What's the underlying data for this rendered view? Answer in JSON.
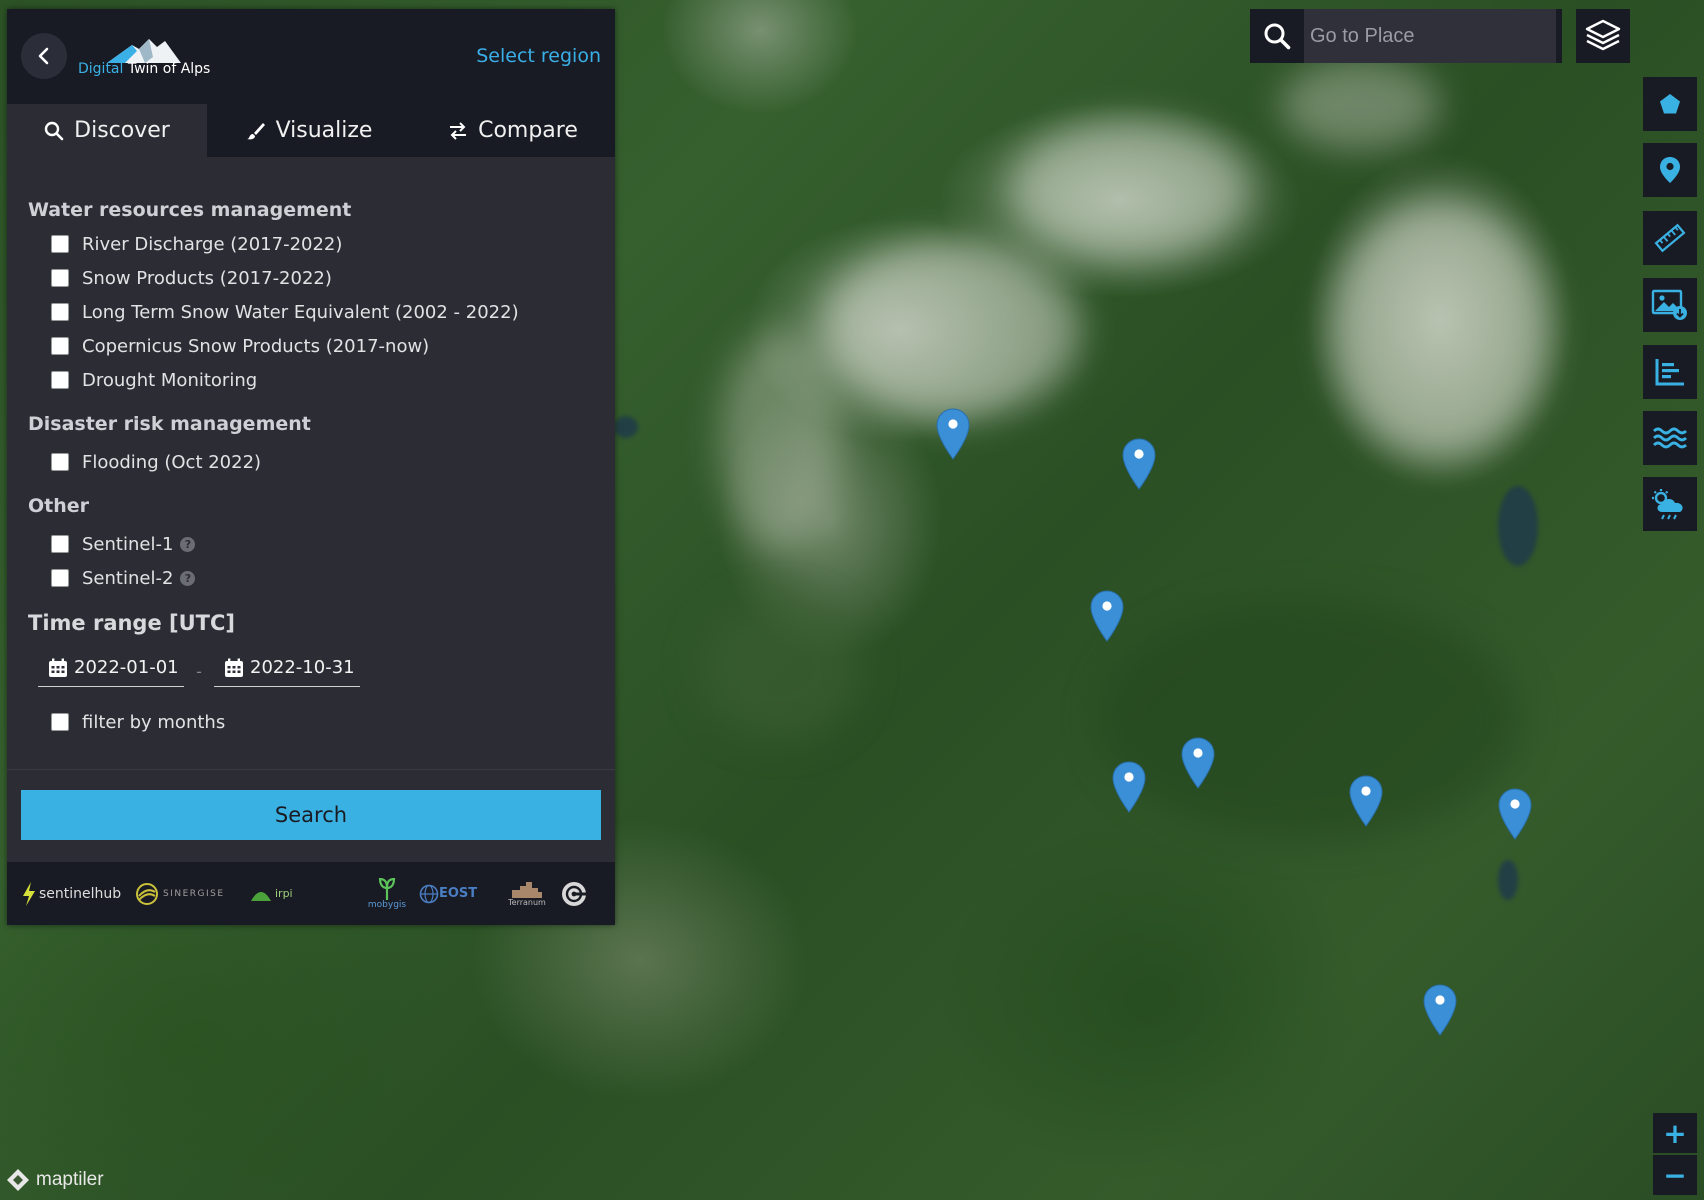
{
  "app": {
    "logo_accent": "Digital",
    "logo_rest": " Twin of Alps",
    "select_region": "Select region"
  },
  "tabs": [
    {
      "label": "Discover",
      "icon": "search-icon",
      "active": true
    },
    {
      "label": "Visualize",
      "icon": "brush-icon",
      "active": false
    },
    {
      "label": "Compare",
      "icon": "swap-icon",
      "active": false
    }
  ],
  "groups": {
    "water": {
      "title": "Water resources management",
      "items": [
        "River Discharge (2017-2022)",
        "Snow Products (2017-2022)",
        "Long Term Snow Water Equivalent (2002 - 2022)",
        "Copernicus Snow Products (2017-now)",
        "Drought Monitoring"
      ]
    },
    "disaster": {
      "title": "Disaster risk management",
      "items": [
        "Flooding (Oct 2022)"
      ]
    },
    "other": {
      "title": "Other",
      "items": [
        "Sentinel-1",
        "Sentinel-2"
      ]
    }
  },
  "time_range": {
    "title": "Time range [UTC]",
    "from": "2022-01-01",
    "separator": "-",
    "to": "2022-10-31",
    "filter_label": "filter by months"
  },
  "search_button": "Search",
  "partner_logos": [
    "sentinelhub",
    "SINERGISE",
    "irpi",
    "mobygis",
    "EOST",
    "Terranum"
  ],
  "place_search": {
    "placeholder": "Go to Place"
  },
  "tools": [
    "pentagon-icon",
    "location-pin-icon",
    "ruler-icon",
    "image-download-icon",
    "chart-icon",
    "water-waves-icon",
    "weather-cloud-icon"
  ],
  "zoom": {
    "in": "+",
    "out": "−"
  },
  "attribution": {
    "brand": "maptiler"
  },
  "colors": {
    "accent": "#3ab1e3",
    "panel": "#2c2d34",
    "header": "#191b24",
    "pin": "#3a8fd6"
  }
}
